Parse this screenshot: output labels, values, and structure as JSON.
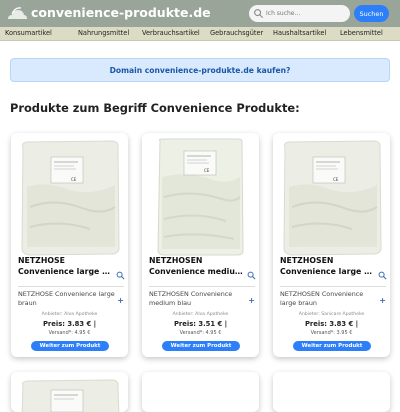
{
  "header": {
    "site_name": "convenience-produkte.de",
    "search_placeholder": "Ich suche...",
    "search_button": "Suchen",
    "logo_icon": "cloud-logo-icon"
  },
  "categories": [
    "Konsumartikel",
    "Nahrungsmittel",
    "Verbrauchsartikel",
    "Gebrauchsgüter",
    "Haushaltsartikel",
    "Lebensmittel"
  ],
  "banner": {
    "text": "Domain convenience-produkte.de kaufen?"
  },
  "section": {
    "title": "Produkte zum Begriff Convenience Produkte:"
  },
  "products": [
    {
      "title_line1": "NETZHOSE",
      "title_line2": "Convenience large braun",
      "description": "NETZHOSE Convenience large braun",
      "vendor": "Anbieter: Alva Apotheke",
      "price": "Preis: 3.83 € |",
      "shipping": "Versand*: 4.95 €",
      "button": "Weiter zum Produkt"
    },
    {
      "title_line1": "NETZHOSEN",
      "title_line2": "Convenience medium blau",
      "description": "NETZHOSEN Convenience medium blau",
      "vendor": "Anbieter: Alva Apotheke",
      "price": "Preis: 3.51 € |",
      "shipping": "Versand*: 4.95 €",
      "button": "Weiter zum Produkt"
    },
    {
      "title_line1": "NETZHOSEN",
      "title_line2": "Convenience large braun",
      "description": "NETZHOSEN Convenience large braun",
      "vendor": "Anbieter: Sanicare Apotheke",
      "price": "Preis: 3.83 € |",
      "shipping": "Versand*: 3.95 €",
      "button": "Weiter zum Produkt"
    }
  ],
  "colors": {
    "topbar": "#9aa59a",
    "catnav": "#dcdcc4",
    "accent": "#2d7ff9",
    "banner_bg": "#d9eafe",
    "banner_text": "#1a57a8"
  }
}
